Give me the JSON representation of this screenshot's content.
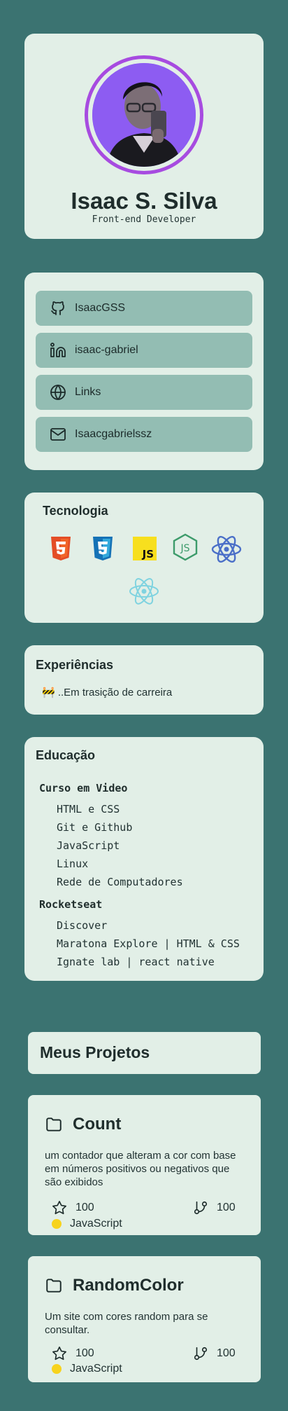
{
  "profile": {
    "name": "Isaac S. Silva",
    "role": "Front-end Developer",
    "avatar_ring_color": "#a74be0",
    "avatar_bg_color": "#8d5cf2"
  },
  "links": [
    {
      "icon": "github-icon",
      "label": "IsaacGSS"
    },
    {
      "icon": "linkedin-icon",
      "label": "isaac-gabriel"
    },
    {
      "icon": "globe-icon",
      "label": "Links"
    },
    {
      "icon": "mail-icon",
      "label": "Isaacgabrielssz"
    }
  ],
  "tech": {
    "title": "Tecnologia",
    "icons": [
      "html5-icon",
      "css3-icon",
      "javascript-icon",
      "nodejs-icon",
      "react-icon",
      "react-native-icon"
    ]
  },
  "experience": {
    "title": "Experiências",
    "text": "🚧 ..Em trasição de carreira"
  },
  "education": {
    "title": "Educação",
    "groups": [
      {
        "name": "Curso em Video",
        "items": [
          "HTML e CSS",
          "Git e Github",
          "JavaScript",
          "Linux",
          "Rede de Computadores"
        ]
      },
      {
        "name": "Rocketseat",
        "items": [
          "Discover",
          "Maratona Explore | HTML & CSS",
          "Ignate lab | react native"
        ]
      }
    ]
  },
  "projects": {
    "title": "Meus Projetos",
    "items": [
      {
        "name": "Count",
        "description": "um contador que alteram a cor com base em números positivos ou negativos que são exibidos",
        "stars": "100",
        "forks": "100",
        "language": "JavaScript",
        "language_color": "#f7d31e"
      },
      {
        "name": "RandomColor",
        "description": "Um site com cores random para se consultar.",
        "stars": "100",
        "forks": "100",
        "language": "JavaScript",
        "language_color": "#f7d31e"
      }
    ]
  }
}
